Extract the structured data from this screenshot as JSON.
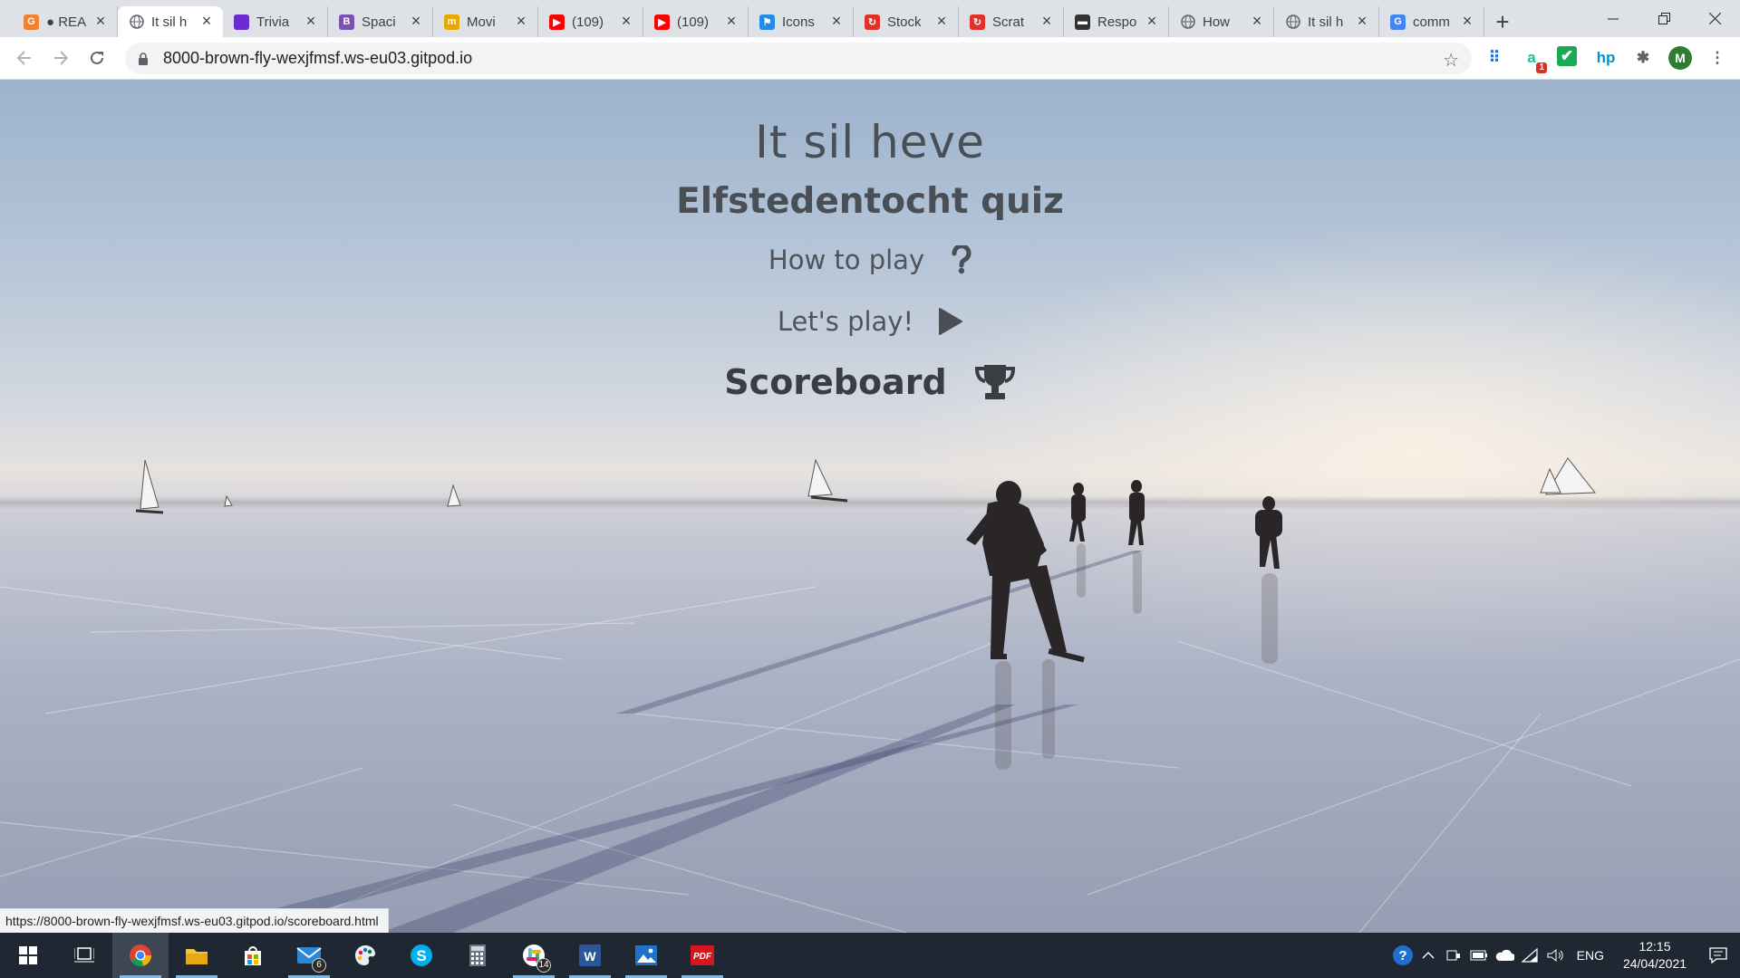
{
  "browser": {
    "tabs": [
      {
        "title": "● REA",
        "icon": "grammarly-g-icon",
        "color": "#f0812f",
        "glyph": "G",
        "active": false
      },
      {
        "title": "It sil h",
        "icon": "globe-icon",
        "color": "#5f6368",
        "glyph": "",
        "active": true
      },
      {
        "title": "Trivia",
        "icon": "trivia-icon",
        "color": "#6b2bd1",
        "glyph": "",
        "active": false
      },
      {
        "title": "Spaci",
        "icon": "bootstrap-b-icon",
        "color": "#7952b3",
        "glyph": "B",
        "active": false
      },
      {
        "title": "Movi",
        "icon": "moviepedia-m-icon",
        "color": "#e8a800",
        "glyph": "m",
        "active": false
      },
      {
        "title": "(109)",
        "icon": "youtube-icon",
        "color": "#ff0000",
        "glyph": "▶",
        "active": false
      },
      {
        "title": "(109)",
        "icon": "youtube-icon",
        "color": "#ff0000",
        "glyph": "▶",
        "active": false
      },
      {
        "title": "Icons",
        "icon": "flag-icon",
        "color": "#228be6",
        "glyph": "⚑",
        "active": false
      },
      {
        "title": "Stock",
        "icon": "stackoverflow-red-icon",
        "color": "#e0312b",
        "glyph": "↻",
        "active": false
      },
      {
        "title": "Scrat",
        "icon": "stackoverflow-red-icon",
        "color": "#e0312b",
        "glyph": "↻",
        "active": false
      },
      {
        "title": "Respo",
        "icon": "laptop-icon",
        "color": "#333333",
        "glyph": "▬",
        "active": false
      },
      {
        "title": "How",
        "icon": "globe-icon",
        "color": "#5f6368",
        "glyph": "",
        "active": false
      },
      {
        "title": "It sil h",
        "icon": "globe-icon",
        "color": "#5f6368",
        "glyph": "",
        "active": false
      },
      {
        "title": "comm",
        "icon": "google-g-icon",
        "color": "#4285f4",
        "glyph": "G",
        "active": false
      }
    ],
    "url": "8000-brown-fly-wexjfmsf.ws-eu03.gitpod.io",
    "extensions": [
      {
        "name": "apps-grid-icon",
        "glyph": "⠿",
        "color": "#1a73e8"
      },
      {
        "name": "grammarly-extension-icon",
        "glyph": "a",
        "color": "#15c39a",
        "badge": "1"
      },
      {
        "name": "todo-check-icon",
        "glyph": "✔",
        "color": "#1aaa55"
      },
      {
        "name": "hp-extension-icon",
        "glyph": "hp",
        "color": "#0096d6"
      },
      {
        "name": "puzzle-extensions-icon",
        "glyph": "✱",
        "color": "#5f6368"
      },
      {
        "name": "profile-avatar-icon",
        "glyph": "M",
        "color": "#2e7d32"
      },
      {
        "name": "kebab-menu-icon",
        "glyph": "⋮",
        "color": "#5f6368"
      }
    ],
    "status_url": "https://8000-brown-fly-wexjfmsf.ws-eu03.gitpod.io/scoreboard.html"
  },
  "page": {
    "title": "It sil heve",
    "subtitle": "Elfstedentocht quiz",
    "menu": {
      "how_to_play": "How to play",
      "lets_play": "Let's play!",
      "scoreboard": "Scoreboard"
    },
    "icons": {
      "how": "question-icon",
      "play": "play-icon",
      "score": "trophy-icon"
    },
    "text_color": "#4a4e55"
  },
  "taskbar": {
    "apps": [
      {
        "name": "windows-start-icon",
        "active": false
      },
      {
        "name": "task-view-icon",
        "active": false
      },
      {
        "name": "chrome-icon",
        "active": true
      },
      {
        "name": "file-explorer-icon",
        "active": false,
        "running": true
      },
      {
        "name": "store-icon",
        "active": false
      },
      {
        "name": "mail-icon",
        "active": false,
        "running": true,
        "badge": "6"
      },
      {
        "name": "paint-icon",
        "active": false
      },
      {
        "name": "skype-icon",
        "active": false
      },
      {
        "name": "calculator-icon",
        "active": false
      },
      {
        "name": "slack-icon",
        "active": false,
        "running": true,
        "badge": "14"
      },
      {
        "name": "word-icon",
        "active": false,
        "running": true
      },
      {
        "name": "photos-icon",
        "active": false,
        "running": true
      },
      {
        "name": "pdf-icon",
        "active": false,
        "running": true
      }
    ],
    "tray": {
      "lang": "ENG",
      "time": "12:15",
      "date": "24/04/2021"
    }
  }
}
